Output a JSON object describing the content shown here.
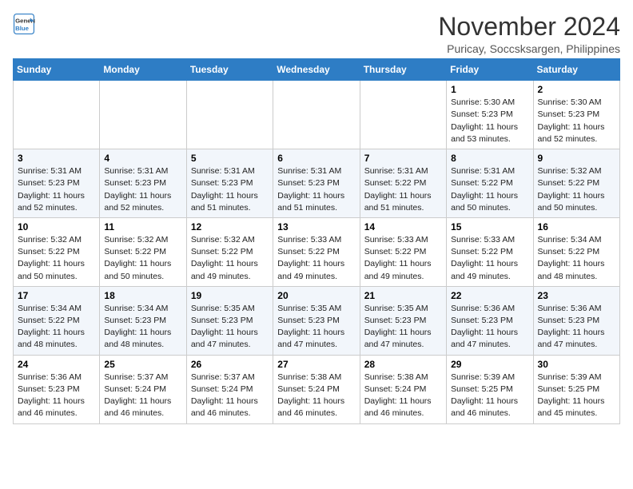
{
  "logo": {
    "line1": "General",
    "line2": "Blue"
  },
  "title": "November 2024",
  "subtitle": "Puricay, Soccsksargen, Philippines",
  "weekdays": [
    "Sunday",
    "Monday",
    "Tuesday",
    "Wednesday",
    "Thursday",
    "Friday",
    "Saturday"
  ],
  "weeks": [
    [
      {
        "day": "",
        "detail": ""
      },
      {
        "day": "",
        "detail": ""
      },
      {
        "day": "",
        "detail": ""
      },
      {
        "day": "",
        "detail": ""
      },
      {
        "day": "",
        "detail": ""
      },
      {
        "day": "1",
        "detail": "Sunrise: 5:30 AM\nSunset: 5:23 PM\nDaylight: 11 hours and 53 minutes."
      },
      {
        "day": "2",
        "detail": "Sunrise: 5:30 AM\nSunset: 5:23 PM\nDaylight: 11 hours and 52 minutes."
      }
    ],
    [
      {
        "day": "3",
        "detail": "Sunrise: 5:31 AM\nSunset: 5:23 PM\nDaylight: 11 hours and 52 minutes."
      },
      {
        "day": "4",
        "detail": "Sunrise: 5:31 AM\nSunset: 5:23 PM\nDaylight: 11 hours and 52 minutes."
      },
      {
        "day": "5",
        "detail": "Sunrise: 5:31 AM\nSunset: 5:23 PM\nDaylight: 11 hours and 51 minutes."
      },
      {
        "day": "6",
        "detail": "Sunrise: 5:31 AM\nSunset: 5:23 PM\nDaylight: 11 hours and 51 minutes."
      },
      {
        "day": "7",
        "detail": "Sunrise: 5:31 AM\nSunset: 5:22 PM\nDaylight: 11 hours and 51 minutes."
      },
      {
        "day": "8",
        "detail": "Sunrise: 5:31 AM\nSunset: 5:22 PM\nDaylight: 11 hours and 50 minutes."
      },
      {
        "day": "9",
        "detail": "Sunrise: 5:32 AM\nSunset: 5:22 PM\nDaylight: 11 hours and 50 minutes."
      }
    ],
    [
      {
        "day": "10",
        "detail": "Sunrise: 5:32 AM\nSunset: 5:22 PM\nDaylight: 11 hours and 50 minutes."
      },
      {
        "day": "11",
        "detail": "Sunrise: 5:32 AM\nSunset: 5:22 PM\nDaylight: 11 hours and 50 minutes."
      },
      {
        "day": "12",
        "detail": "Sunrise: 5:32 AM\nSunset: 5:22 PM\nDaylight: 11 hours and 49 minutes."
      },
      {
        "day": "13",
        "detail": "Sunrise: 5:33 AM\nSunset: 5:22 PM\nDaylight: 11 hours and 49 minutes."
      },
      {
        "day": "14",
        "detail": "Sunrise: 5:33 AM\nSunset: 5:22 PM\nDaylight: 11 hours and 49 minutes."
      },
      {
        "day": "15",
        "detail": "Sunrise: 5:33 AM\nSunset: 5:22 PM\nDaylight: 11 hours and 49 minutes."
      },
      {
        "day": "16",
        "detail": "Sunrise: 5:34 AM\nSunset: 5:22 PM\nDaylight: 11 hours and 48 minutes."
      }
    ],
    [
      {
        "day": "17",
        "detail": "Sunrise: 5:34 AM\nSunset: 5:22 PM\nDaylight: 11 hours and 48 minutes."
      },
      {
        "day": "18",
        "detail": "Sunrise: 5:34 AM\nSunset: 5:23 PM\nDaylight: 11 hours and 48 minutes."
      },
      {
        "day": "19",
        "detail": "Sunrise: 5:35 AM\nSunset: 5:23 PM\nDaylight: 11 hours and 47 minutes."
      },
      {
        "day": "20",
        "detail": "Sunrise: 5:35 AM\nSunset: 5:23 PM\nDaylight: 11 hours and 47 minutes."
      },
      {
        "day": "21",
        "detail": "Sunrise: 5:35 AM\nSunset: 5:23 PM\nDaylight: 11 hours and 47 minutes."
      },
      {
        "day": "22",
        "detail": "Sunrise: 5:36 AM\nSunset: 5:23 PM\nDaylight: 11 hours and 47 minutes."
      },
      {
        "day": "23",
        "detail": "Sunrise: 5:36 AM\nSunset: 5:23 PM\nDaylight: 11 hours and 47 minutes."
      }
    ],
    [
      {
        "day": "24",
        "detail": "Sunrise: 5:36 AM\nSunset: 5:23 PM\nDaylight: 11 hours and 46 minutes."
      },
      {
        "day": "25",
        "detail": "Sunrise: 5:37 AM\nSunset: 5:24 PM\nDaylight: 11 hours and 46 minutes."
      },
      {
        "day": "26",
        "detail": "Sunrise: 5:37 AM\nSunset: 5:24 PM\nDaylight: 11 hours and 46 minutes."
      },
      {
        "day": "27",
        "detail": "Sunrise: 5:38 AM\nSunset: 5:24 PM\nDaylight: 11 hours and 46 minutes."
      },
      {
        "day": "28",
        "detail": "Sunrise: 5:38 AM\nSunset: 5:24 PM\nDaylight: 11 hours and 46 minutes."
      },
      {
        "day": "29",
        "detail": "Sunrise: 5:39 AM\nSunset: 5:25 PM\nDaylight: 11 hours and 46 minutes."
      },
      {
        "day": "30",
        "detail": "Sunrise: 5:39 AM\nSunset: 5:25 PM\nDaylight: 11 hours and 45 minutes."
      }
    ]
  ]
}
